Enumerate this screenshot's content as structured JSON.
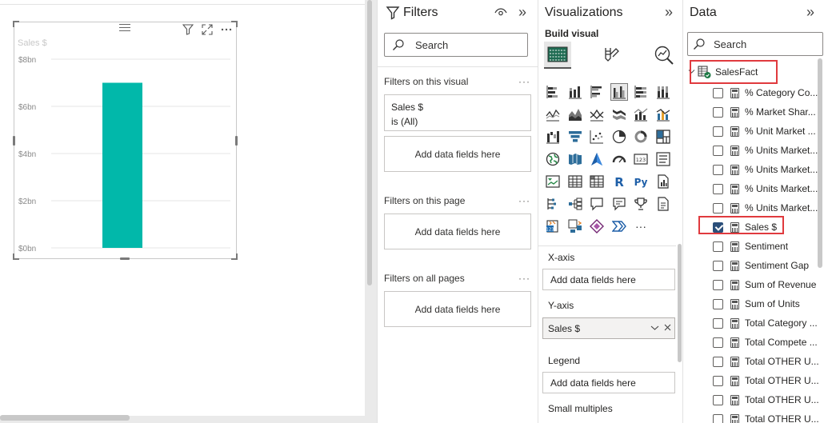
{
  "visual": {
    "title": "Sales $"
  },
  "chart_data": {
    "type": "bar",
    "title": "Sales $",
    "categories": [
      ""
    ],
    "values": [
      7.0
    ],
    "ylim": [
      0,
      8
    ],
    "y_ticks": [
      "$0bn",
      "$2bn",
      "$4bn",
      "$6bn",
      "$8bn"
    ],
    "y_tick_values": [
      0,
      2,
      4,
      6,
      8
    ],
    "bar_color": "#01b8aa",
    "grid": true
  },
  "filters": {
    "title": "Filters",
    "search_placeholder": "Search",
    "on_visual_label": "Filters on this visual",
    "on_page_label": "Filters on this page",
    "on_all_pages_label": "Filters on all pages",
    "more": "···",
    "card_field": "Sales $",
    "card_condition": "is (All)",
    "drop_label": "Add data fields here"
  },
  "viz": {
    "title": "Visualizations",
    "build_visual": "Build visual",
    "more_visuals": "···",
    "wells": {
      "xaxis_label": "X-axis",
      "xaxis_drop": "Add data fields here",
      "yaxis_label": "Y-axis",
      "yaxis_field": "Sales $",
      "legend_label": "Legend",
      "legend_drop": "Add data fields here",
      "small_multiples_label": "Small multiples"
    },
    "r_label": "R",
    "py_label": "Py",
    "kpi_label": "123"
  },
  "data": {
    "title": "Data",
    "search_placeholder": "Search",
    "table_name": "SalesFact",
    "fields": [
      {
        "name": "% Category Co...",
        "checked": false
      },
      {
        "name": "% Market Shar...",
        "checked": false
      },
      {
        "name": "% Unit Market ...",
        "checked": false
      },
      {
        "name": "% Units Market...",
        "checked": false
      },
      {
        "name": "% Units Market...",
        "checked": false
      },
      {
        "name": "% Units Market...",
        "checked": false
      },
      {
        "name": "% Units Market...",
        "checked": false
      },
      {
        "name": "Sales $",
        "checked": true
      },
      {
        "name": "Sentiment",
        "checked": false
      },
      {
        "name": "Sentiment Gap",
        "checked": false
      },
      {
        "name": "Sum of Revenue",
        "checked": false
      },
      {
        "name": "Sum of Units",
        "checked": false
      },
      {
        "name": "Total Category ...",
        "checked": false
      },
      {
        "name": "Total Compete ...",
        "checked": false
      },
      {
        "name": "Total OTHER U...",
        "checked": false
      },
      {
        "name": "Total OTHER U...",
        "checked": false
      },
      {
        "name": "Total OTHER U...",
        "checked": false
      },
      {
        "name": "Total OTHER U...",
        "checked": false
      }
    ]
  },
  "colors": {
    "accent_teal": "#01b8aa",
    "highlight_red": "#e03a3e",
    "checkbox_blue": "#2b4f7a"
  }
}
